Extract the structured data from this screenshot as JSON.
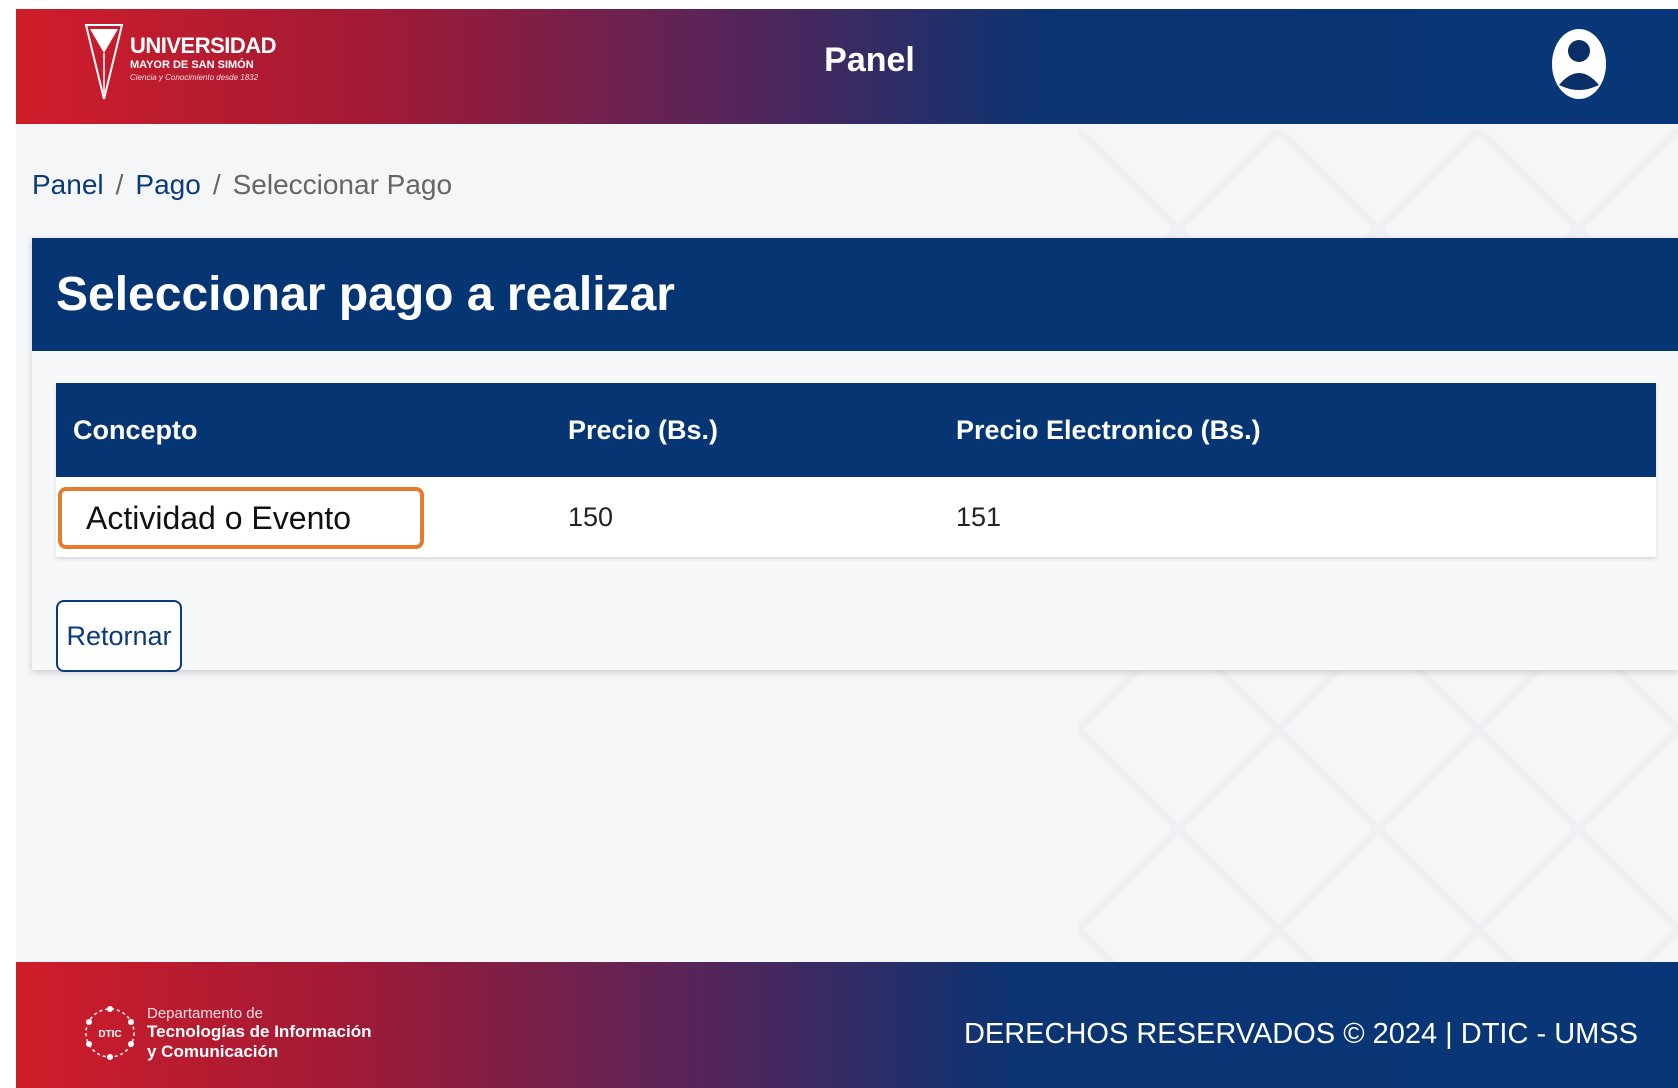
{
  "header": {
    "logo": {
      "line1": "UNIVERSIDAD",
      "line2": "MAYOR DE SAN SIMÓN",
      "line3": "Ciencia y Conocimiento desde 1832"
    },
    "title": "Panel",
    "user_icon": "user-circle-icon"
  },
  "breadcrumb": {
    "items": [
      "Panel",
      "Pago",
      "Seleccionar Pago"
    ],
    "separator": "/"
  },
  "card": {
    "title": "Seleccionar pago a realizar",
    "table": {
      "headers": [
        "Concepto",
        "Precio (Bs.)",
        "Precio Electronico (Bs.)"
      ],
      "rows": [
        {
          "concepto": "Actividad o Evento",
          "precio": "150",
          "precio_electronico": "151"
        }
      ]
    },
    "return_button": "Retornar"
  },
  "footer": {
    "logo": {
      "line1": "Departamento de",
      "line2": "Tecnologías de Información",
      "line3": "y Comunicación",
      "badge": "DTIC"
    },
    "copyright": "DERECHOS RESERVADOS © 2024 | DTIC - UMSS"
  },
  "colors": {
    "primary": "#063574",
    "brand_red": "#d01d2a",
    "highlight": "#e67a2d"
  }
}
